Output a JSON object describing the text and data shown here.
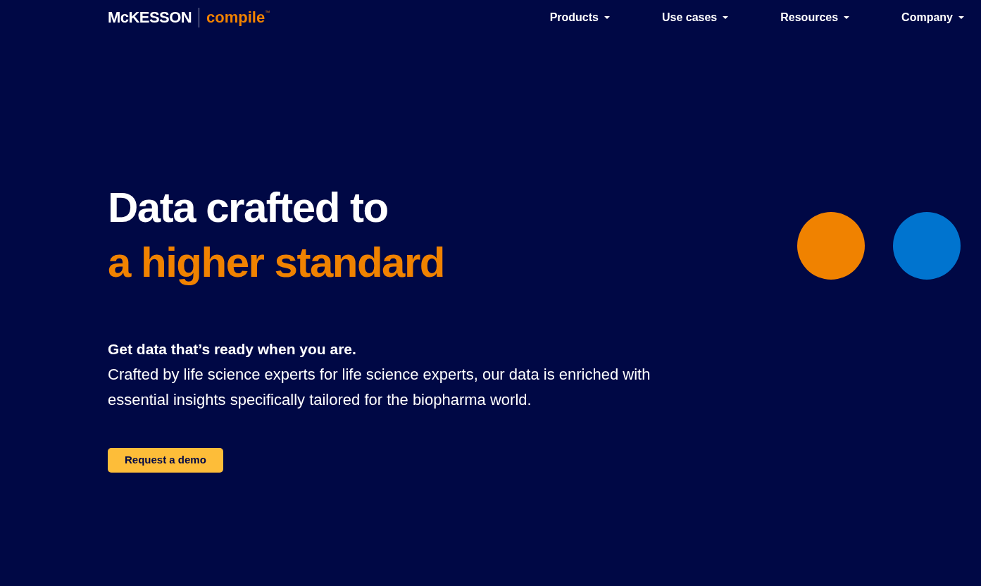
{
  "logo": {
    "brand": "McKESSON",
    "product": "compile",
    "trademark": "™"
  },
  "nav": [
    {
      "label": "Products"
    },
    {
      "label": "Use cases"
    },
    {
      "label": "Resources"
    },
    {
      "label": "Company"
    }
  ],
  "hero": {
    "title_line_1": "Data crafted to",
    "title_line_2": "a higher standard",
    "lead": "Get data that’s ready when you are.",
    "body": "Crafted by life science experts for life science experts, our data is enriched with essential insights specifically tailored for the biopharma world.",
    "cta": "Request a demo"
  },
  "dots": [
    {
      "color": "#f08200"
    },
    {
      "color": "#0074cf"
    }
  ]
}
